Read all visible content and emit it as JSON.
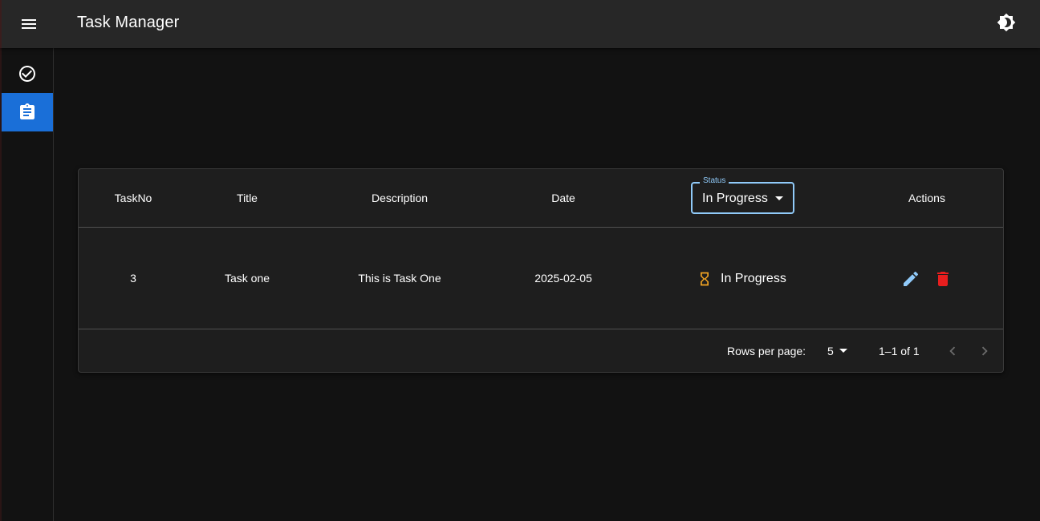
{
  "appbar": {
    "title": "Task Manager"
  },
  "icons": {
    "menu": "menu-icon",
    "theme": "brightness-icon",
    "tasks": "check-circle-icon",
    "board": "clipboard-icon",
    "status": "hourglass-icon",
    "edit": "pencil-icon",
    "delete": "trash-icon",
    "prev": "chevron-left-icon",
    "next": "chevron-right-icon"
  },
  "colors": {
    "accent": "#1a6fd8",
    "status_in_progress": "#f5a623",
    "edit": "#90caf9",
    "delete": "#e53935"
  },
  "table": {
    "headers": {
      "task_no": "TaskNo",
      "title": "Title",
      "description": "Description",
      "date": "Date",
      "actions": "Actions"
    },
    "status_filter": {
      "label": "Status",
      "value": "In Progress"
    },
    "rows": [
      {
        "task_no": "3",
        "title": "Task one",
        "description": "This is Task One",
        "date": "2025-02-05",
        "status": "In Progress"
      }
    ],
    "pagination": {
      "rows_per_page_label": "Rows per page:",
      "rows_per_page": "5",
      "range": "1–1 of 1"
    }
  }
}
